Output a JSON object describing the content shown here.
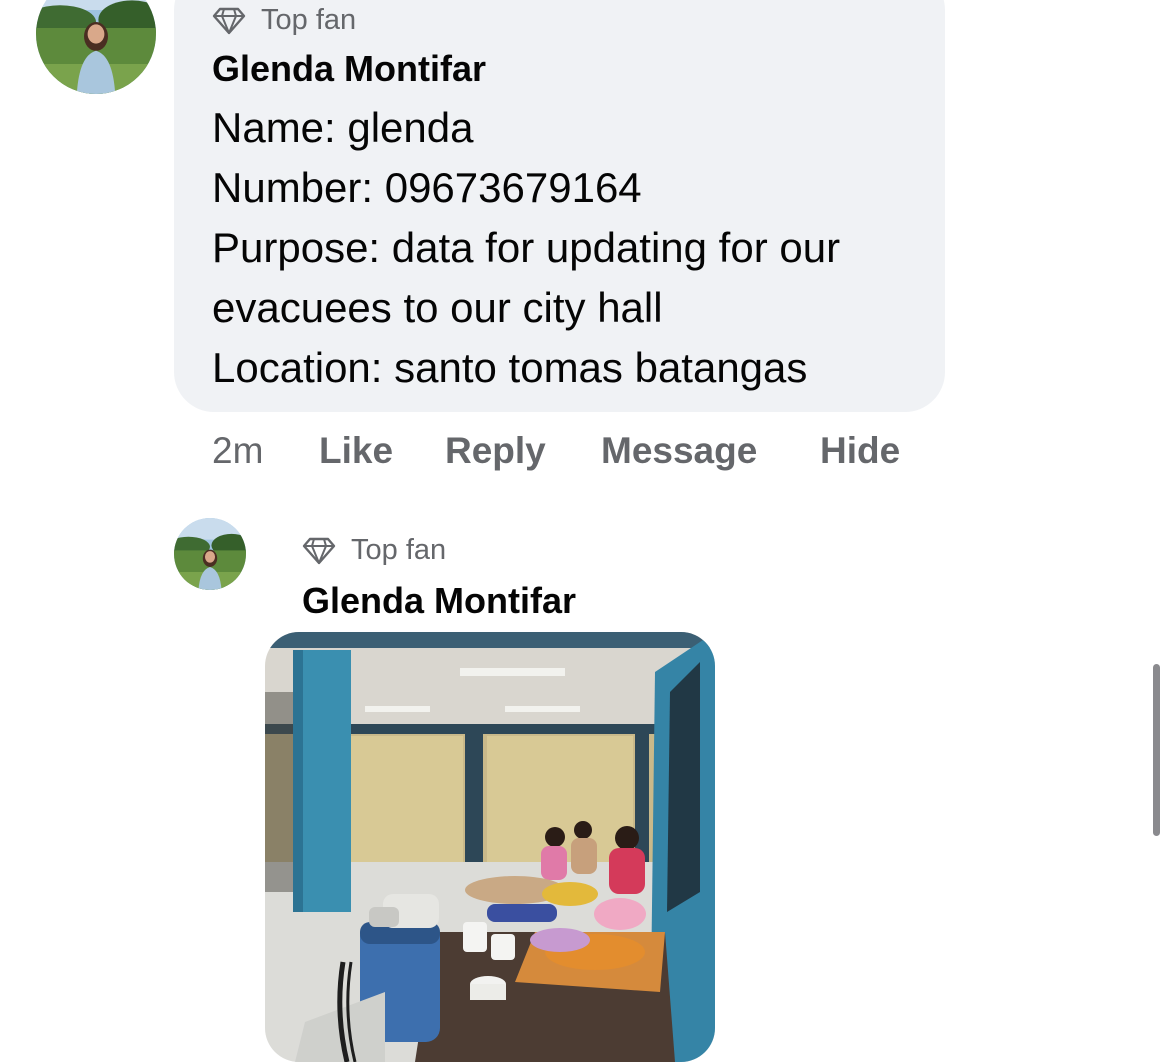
{
  "comments": [
    {
      "badge": "Top fan",
      "author": "Glenda Montifar",
      "lines": [
        "Name: glenda",
        "Number: 09673679164",
        "Purpose: data for updating for our",
        "evacuees to our city hall",
        "Location: santo tomas batangas"
      ],
      "time": "2m",
      "actions": {
        "like": "Like",
        "reply": "Reply",
        "message": "Message",
        "hide": "Hide"
      }
    },
    {
      "badge": "Top fan",
      "author": "Glenda Montifar"
    }
  ],
  "icons": {
    "badge": "diamond-icon"
  },
  "colors": {
    "bubble": "#f0f2f5",
    "secondary_text": "#65676b",
    "primary_text": "#050505"
  }
}
